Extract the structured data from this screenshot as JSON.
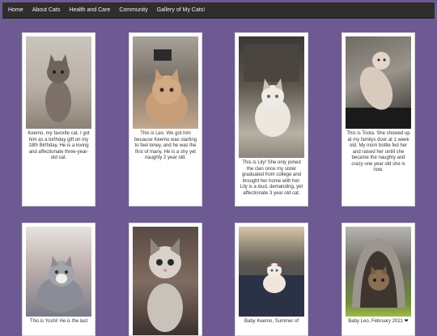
{
  "nav": {
    "items": [
      {
        "label": "Home"
      },
      {
        "label": "About Cats"
      },
      {
        "label": "Health and Care"
      },
      {
        "label": "Community"
      },
      {
        "label": "Gallery of My Cats!"
      }
    ]
  },
  "gallery": {
    "cards": [
      {
        "caption": "Keemo, my favorite cat. I got him as a birthday gift on my 18th Birthday. He is a loving and affectionate three-year-old cat."
      },
      {
        "caption": "This is Leo. We got him because Keemo was starting to feel loney, and he was the first of many. He is a shy yet naughty 2 year old."
      },
      {
        "caption": "This is Lily! She only joined the clan once my sister graduated from college and brought her home with her. Lily is a loud, demanding, yet affectionate 3 year old cat."
      },
      {
        "caption": "This is Toota. She showed up at my familys door at 1 week old. My mom bottle fed her and raised her untill she became the naughty and crazy one year old she is now."
      },
      {
        "caption": "This is Yoshi! He is the last"
      },
      {
        "caption": ""
      },
      {
        "caption": "Baby Keemo, Summer of"
      },
      {
        "caption": "Baby Leo, February 2021 ❤"
      }
    ]
  }
}
